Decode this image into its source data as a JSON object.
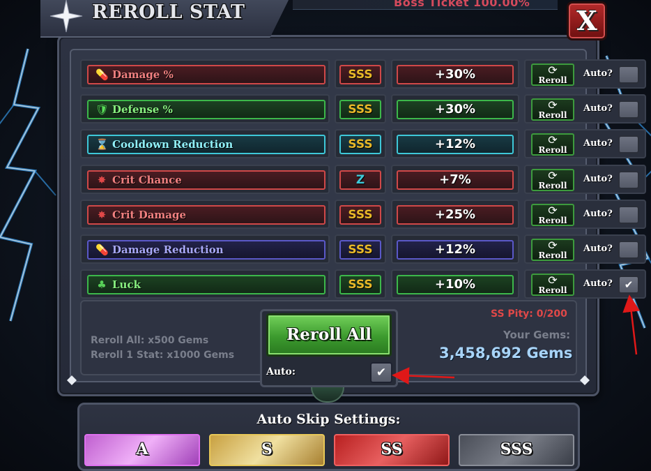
{
  "header": {
    "title": "REROLL STAT",
    "boss_ticket": "Boss Ticket 100.00%",
    "close_label": "X"
  },
  "stats": [
    {
      "name": "Damage %",
      "rank": "SSS",
      "value": "+30%",
      "theme": "red",
      "icon": "potion-icon",
      "auto_checked": false
    },
    {
      "name": "Defense %",
      "rank": "SSS",
      "value": "+30%",
      "theme": "green",
      "icon": "shield-icon",
      "auto_checked": false
    },
    {
      "name": "Cooldown Reduction",
      "rank": "SSS",
      "value": "+12%",
      "theme": "cyan",
      "icon": "hourglass-icon",
      "auto_checked": false
    },
    {
      "name": "Crit Chance",
      "rank": "Z",
      "value": "+7%",
      "theme": "red",
      "icon": "crit-icon",
      "auto_checked": false
    },
    {
      "name": "Crit Damage",
      "rank": "SSS",
      "value": "+25%",
      "theme": "red",
      "icon": "crit-icon",
      "auto_checked": false
    },
    {
      "name": "Damage Reduction",
      "rank": "SSS",
      "value": "+12%",
      "theme": "blue",
      "icon": "potion-icon",
      "auto_checked": false
    },
    {
      "name": "Luck",
      "rank": "SSS",
      "value": "+10%",
      "theme": "green",
      "icon": "clover-icon",
      "auto_checked": true
    }
  ],
  "row_labels": {
    "reroll": "Reroll",
    "auto": "Auto?"
  },
  "costs": {
    "reroll_all": "Reroll All: x500 Gems",
    "reroll_one": "Reroll 1 Stat: x1000 Gems"
  },
  "pity": "SS Pity: 0/200",
  "gems": {
    "label": "Your Gems:",
    "value": "3,458,692 Gems"
  },
  "reroll_all": {
    "button_label": "Reroll All",
    "auto_label": "Auto:",
    "auto_checked": true
  },
  "auto_skip": {
    "title": "Auto Skip Settings:",
    "options": [
      "A",
      "S",
      "SS",
      "SSS"
    ]
  },
  "colors": {
    "red": "#d04848",
    "green": "#3cb84a",
    "cyan": "#3ec8d8",
    "blue": "#5a58c8",
    "rank_gold": "#e8b828",
    "rank_z": "#3ec8d8",
    "gems_blue": "#a8d4f8",
    "pity_red": "#e04848"
  }
}
